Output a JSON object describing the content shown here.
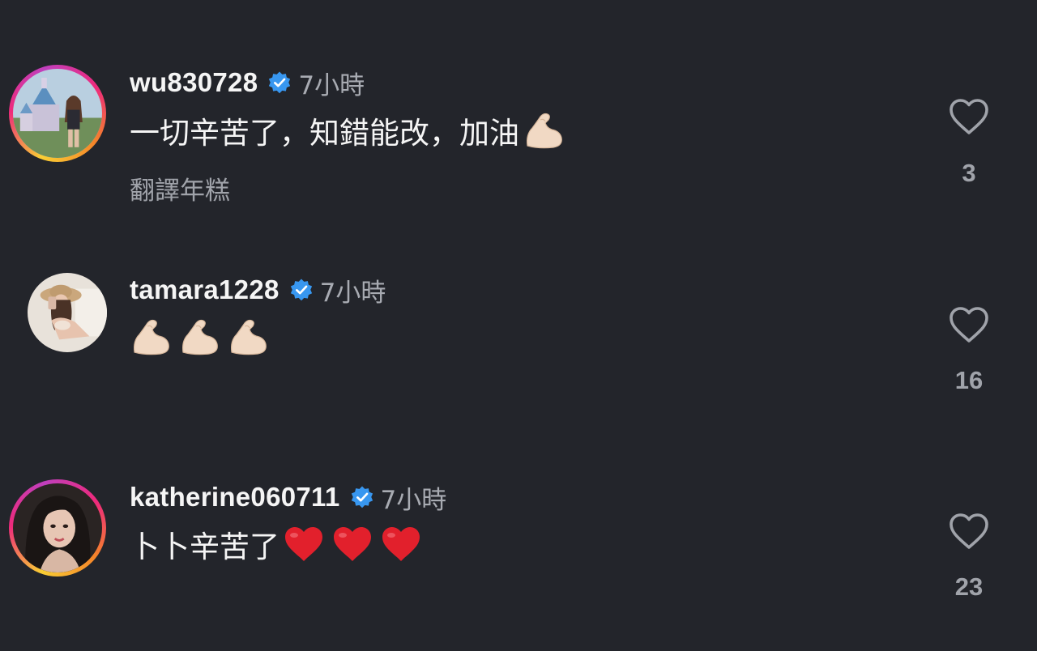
{
  "comments": [
    {
      "username": "wu830728",
      "time": "7小時",
      "text": "一切辛苦了，知錯能改，加油",
      "translate_label": "翻譯年糕",
      "likes": "3"
    },
    {
      "username": "tamara1228",
      "time": "7小時",
      "text": "",
      "likes": "16"
    },
    {
      "username": "katherine060711",
      "time": "7小時",
      "text": "卜卜辛苦了",
      "likes": "23"
    }
  ],
  "colors": {
    "background": "#23252b",
    "verified": "#3897f0",
    "heart": "#e2202c",
    "secondary_text": "#a8abb2"
  },
  "icons": [
    "verified-badge-icon",
    "heart-outline-icon",
    "flexed-biceps-emoji",
    "red-heart-emoji"
  ]
}
